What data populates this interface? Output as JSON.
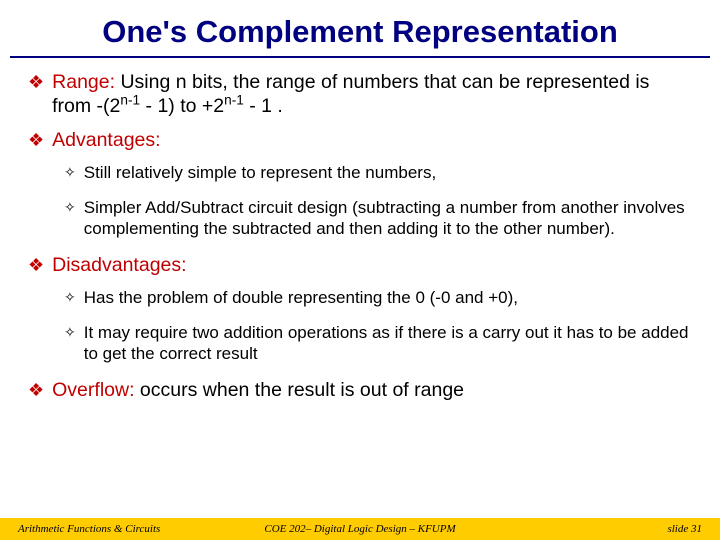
{
  "title": "One's Complement Representation",
  "bullets": {
    "range_label": "Range:",
    "range_text": " Using n bits, the range of numbers that can be represented is from -(2",
    "range_exp1": "n-1",
    "range_mid": " - 1) to +2",
    "range_exp2": "n-1",
    "range_end": " - 1 .",
    "adv_label": "Advantages:",
    "adv1": "Still relatively simple to represent the numbers,",
    "adv2": "Simpler Add/Subtract circuit design (subtracting a number from another involves complementing the subtracted and then adding it to the other number).",
    "dis_label": "Disadvantages:",
    "dis1": "Has the problem of double representing the 0 (-0 and +0),",
    "dis2": "It may require two addition operations as if there is a carry out it has to be added to get the correct result",
    "ovf_label": "Overflow:",
    "ovf_text": " occurs when the result is out of range"
  },
  "footer": {
    "left": "Arithmetic Functions & Circuits",
    "center": "COE 202– Digital Logic Design – KFUPM",
    "right": "slide 31"
  }
}
